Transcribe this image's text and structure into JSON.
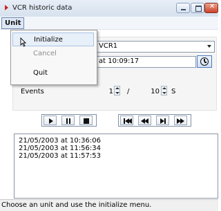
{
  "window": {
    "title": "VCR historic data",
    "icons": {
      "app": "app-icon",
      "minimize": "minimize-icon",
      "maximize": "maximize-icon",
      "close": "close-icon"
    }
  },
  "menubar": {
    "items": [
      {
        "label": "Unit"
      }
    ]
  },
  "unit_menu": {
    "items": [
      {
        "label": "Initialize",
        "enabled": true,
        "hovered": true
      },
      {
        "label": "Cancel",
        "enabled": false
      },
      {
        "label": "Quit",
        "enabled": true
      }
    ]
  },
  "form": {
    "vcr_select": {
      "value": "VCR1"
    },
    "start_time": {
      "value": "at 10:09:17"
    },
    "events": {
      "label": "Events",
      "from": "1",
      "separator": "/",
      "to": "10",
      "unit": "S"
    }
  },
  "media_controls": {
    "group1": [
      "play-icon",
      "pause-icon",
      "stop-icon"
    ],
    "group2": [
      "skip-to-start-icon",
      "rewind-icon",
      "step-icon",
      "fast-forward-icon"
    ]
  },
  "log": {
    "lines": [
      "21/05/2003 at 10:36:06",
      "21/05/2003 at 11:56:34",
      "21/05/2003 at 11:57:53"
    ]
  },
  "status": {
    "text": "Choose an unit and use the initialize menu."
  },
  "colors": {
    "close_button": "#c9432a",
    "highlight": "#e7eff8",
    "disabled_text": "#8a8a8a"
  }
}
